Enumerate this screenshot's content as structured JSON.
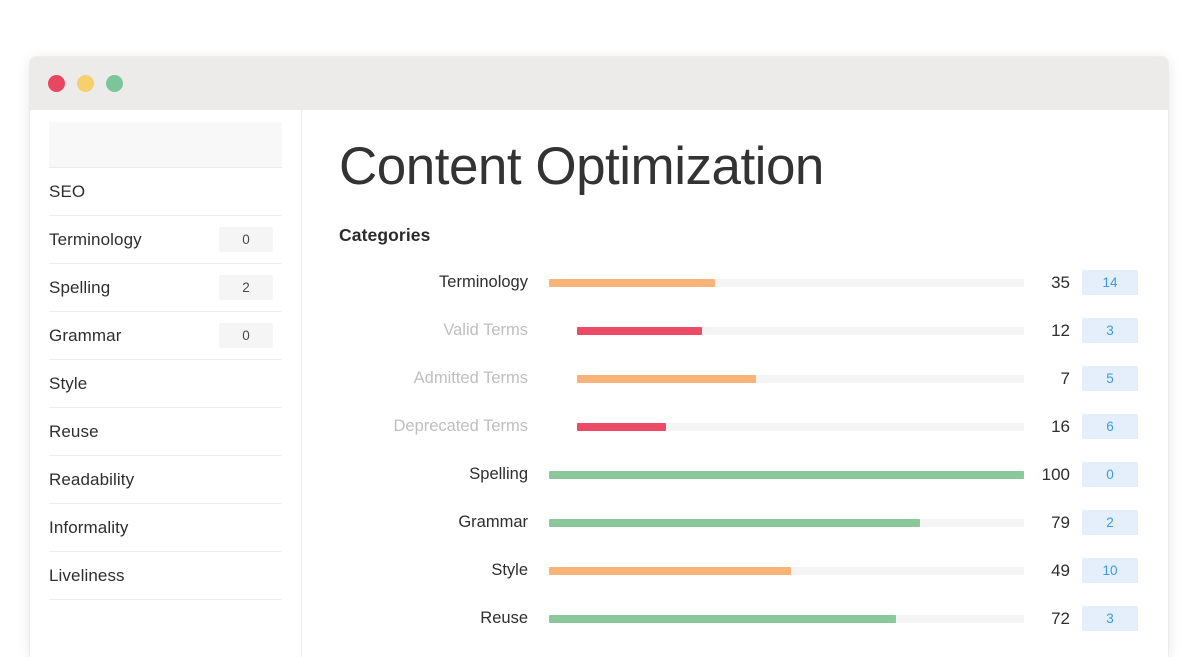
{
  "window": {
    "traffic_lights": [
      {
        "name": "close",
        "color": "#e8475f"
      },
      {
        "name": "minimize",
        "color": "#f5d06c"
      },
      {
        "name": "maximize",
        "color": "#7cc49a"
      }
    ]
  },
  "sidebar": {
    "search_placeholder": "",
    "search_value": "",
    "items": [
      {
        "label": "SEO",
        "count": ""
      },
      {
        "label": "Terminology",
        "count": "0"
      },
      {
        "label": "Spelling",
        "count": "2"
      },
      {
        "label": "Grammar",
        "count": "0"
      },
      {
        "label": "Style",
        "count": ""
      },
      {
        "label": "Reuse",
        "count": ""
      },
      {
        "label": "Readability",
        "count": ""
      },
      {
        "label": "Informality",
        "count": ""
      },
      {
        "label": "Liveliness",
        "count": ""
      }
    ]
  },
  "main": {
    "title": "Content Optimization",
    "section_heading": "Categories"
  },
  "colors": {
    "green": "#8cc79a",
    "orange": "#f8b478",
    "red": "#ed4a63",
    "track": "#f4f4f4",
    "badge_bg": "#e4effb",
    "badge_text": "#3c9be8",
    "titlebar": "#ecebe9"
  },
  "chart_data": {
    "type": "bar",
    "title": "Categories",
    "xlabel": "",
    "ylabel": "",
    "xlim": [
      0,
      100
    ],
    "grid": false,
    "legend": false,
    "orientation": "horizontal",
    "value_column_header": "",
    "badge_column_header": "",
    "categories": [
      "Terminology",
      "Valid Terms",
      "Admitted Terms",
      "Deprecated Terms",
      "Spelling",
      "Grammar",
      "Style",
      "Reuse"
    ],
    "values": [
      35,
      12,
      7,
      16,
      100,
      79,
      49,
      72
    ],
    "badges": [
      14,
      3,
      5,
      6,
      0,
      2,
      10,
      3
    ],
    "rows": [
      {
        "label": "Terminology",
        "value": "35",
        "bar_percent": 35,
        "color": "orange",
        "badge": "14",
        "sub": false
      },
      {
        "label": "Valid Terms",
        "value": "12",
        "bar_percent": 28,
        "color": "red",
        "badge": "3",
        "sub": true
      },
      {
        "label": "Admitted Terms",
        "value": "7",
        "bar_percent": 40,
        "color": "orange",
        "badge": "5",
        "sub": true
      },
      {
        "label": "Deprecated Terms",
        "value": "16",
        "bar_percent": 20,
        "color": "red",
        "badge": "6",
        "sub": true
      },
      {
        "label": "Spelling",
        "value": "100",
        "bar_percent": 100,
        "color": "green",
        "badge": "0",
        "sub": false
      },
      {
        "label": "Grammar",
        "value": "79",
        "bar_percent": 78,
        "color": "green",
        "badge": "2",
        "sub": false
      },
      {
        "label": "Style",
        "value": "49",
        "bar_percent": 51,
        "color": "orange",
        "badge": "10",
        "sub": false
      },
      {
        "label": "Reuse",
        "value": "72",
        "bar_percent": 73,
        "color": "green",
        "badge": "3",
        "sub": false
      }
    ]
  }
}
